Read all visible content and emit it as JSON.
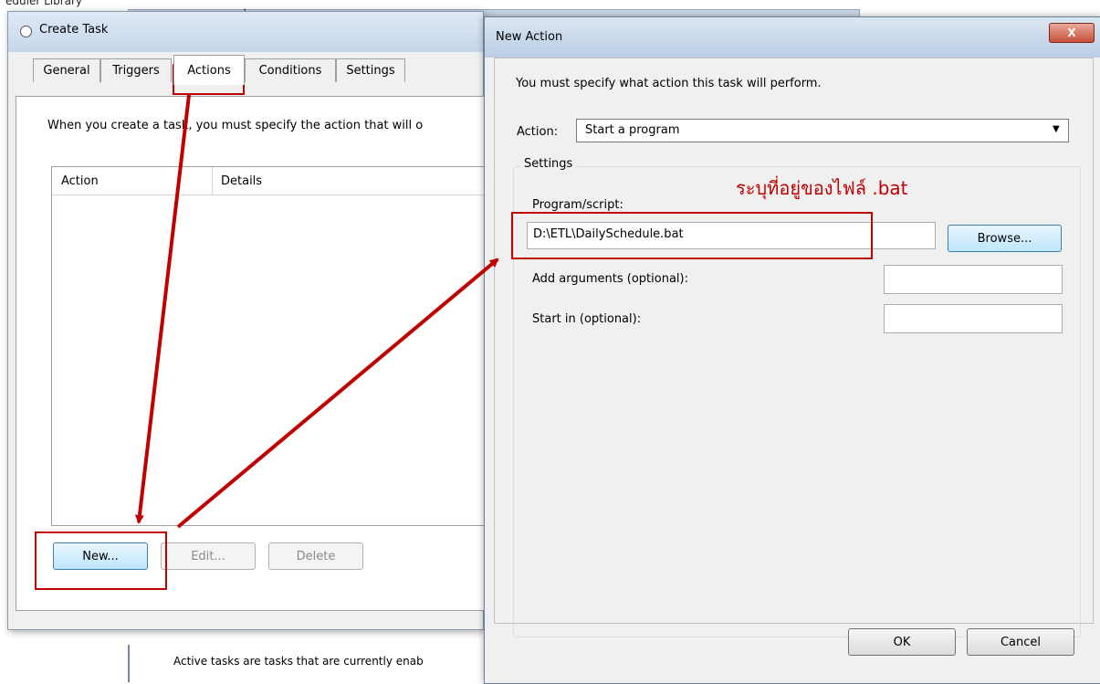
{
  "background": {
    "top_text": "eduler Library",
    "top_mark": "ุ",
    "bottom_text": "Active tasks are tasks that are currently enab"
  },
  "create_task": {
    "title": "Create Task",
    "tabs": [
      {
        "label": "General",
        "active": false
      },
      {
        "label": "Triggers",
        "active": false
      },
      {
        "label": "Actions",
        "active": true
      },
      {
        "label": "Conditions",
        "active": false
      },
      {
        "label": "Settings",
        "active": false
      }
    ],
    "instruction": "When you create a task, you must specify the action that will o",
    "columns": {
      "action": "Action",
      "details": "Details"
    },
    "buttons": {
      "new": "New...",
      "edit": "Edit...",
      "delete": "Delete"
    }
  },
  "new_action": {
    "title": "New Action",
    "close_symbol": "X",
    "instruction": "You must specify what action this task will perform.",
    "action_label": "Action:",
    "action_value": "Start a program",
    "settings_legend": "Settings",
    "program_label": "Program/script:",
    "program_value": "D:\\ETL\\DailySchedule.bat",
    "browse": "Browse...",
    "args_label": "Add arguments (optional):",
    "startin_label": "Start in (optional):",
    "ok": "OK",
    "cancel": "Cancel"
  },
  "annotation": {
    "note": "ระบุที่อยู่ของไฟล์ .bat",
    "color": "#c00000"
  }
}
